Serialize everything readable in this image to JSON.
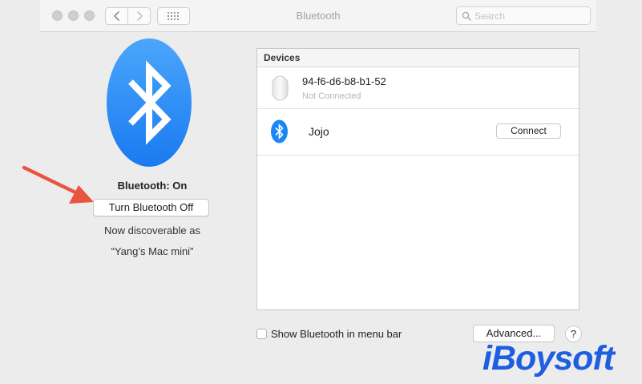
{
  "window": {
    "title": "Bluetooth",
    "search_placeholder": "Search"
  },
  "bluetooth": {
    "status": "Bluetooth: On",
    "toggle_label": "Turn Bluetooth Off",
    "discoverable_prefix": "Now discoverable as",
    "device_name": "“Yang’s Mac mini”",
    "brand_color": "#1a87f5"
  },
  "devices": {
    "header": "Devices",
    "items": [
      {
        "name": "94-f6-d6-b8-b1-52",
        "status": "Not Connected",
        "icon": "mouse-icon"
      },
      {
        "name": "Jojo",
        "action_label": "Connect",
        "icon": "bluetooth-icon"
      }
    ]
  },
  "footer": {
    "show_in_menubar_label": "Show Bluetooth in menu bar",
    "show_in_menubar_checked": false,
    "advanced_label": "Advanced...",
    "help_label": "?"
  },
  "annotation": {
    "arrow_color": "#e8553f",
    "watermark": "iBoysoft"
  }
}
